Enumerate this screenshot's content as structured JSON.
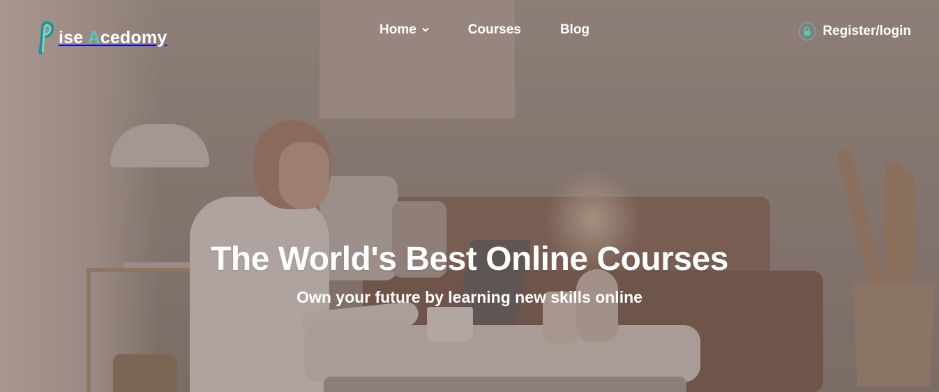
{
  "brand": {
    "logo_letter": "P",
    "name_prefix": "ise ",
    "name_accent": "A",
    "name_rest": "cedomy",
    "accent_color": "#54c7c0"
  },
  "nav": {
    "items": [
      {
        "label": "Home",
        "has_dropdown": true,
        "icon": "chevron-down-icon"
      },
      {
        "label": "Courses",
        "has_dropdown": false
      },
      {
        "label": "Blog",
        "has_dropdown": false
      }
    ]
  },
  "auth": {
    "label": "Register/login",
    "icon": "lock-icon"
  },
  "hero": {
    "title": "The World's Best Online Courses",
    "subtitle": "Own your future by learning new skills online"
  }
}
